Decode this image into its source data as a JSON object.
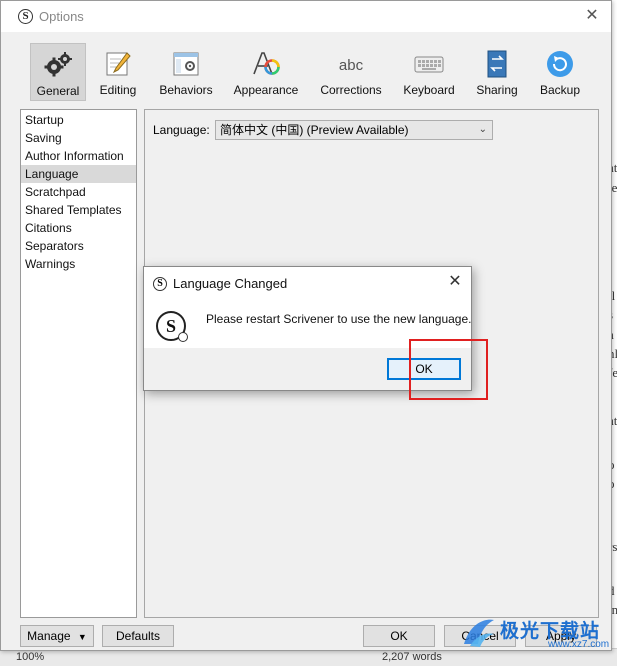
{
  "window": {
    "title": "Options"
  },
  "toolbar": {
    "items": [
      {
        "label": "General",
        "icon": "gears-icon",
        "active": true
      },
      {
        "label": "Editing",
        "icon": "pencil-note-icon"
      },
      {
        "label": "Behaviors",
        "icon": "window-gear-icon"
      },
      {
        "label": "Appearance",
        "icon": "font-palette-icon"
      },
      {
        "label": "Corrections",
        "icon": "abc-icon"
      },
      {
        "label": "Keyboard",
        "icon": "keyboard-icon"
      },
      {
        "label": "Sharing",
        "icon": "sync-document-icon"
      },
      {
        "label": "Backup",
        "icon": "backup-circle-icon"
      }
    ]
  },
  "sidebar": {
    "items": [
      {
        "label": "Startup"
      },
      {
        "label": "Saving"
      },
      {
        "label": "Author Information"
      },
      {
        "label": "Language",
        "selected": true
      },
      {
        "label": "Scratchpad"
      },
      {
        "label": "Shared Templates"
      },
      {
        "label": "Citations"
      },
      {
        "label": "Separators"
      },
      {
        "label": "Warnings"
      }
    ]
  },
  "content": {
    "language_label": "Language:",
    "language_value": "简体中文 (中国) (Preview Available)"
  },
  "footer": {
    "manage": "Manage",
    "defaults": "Defaults",
    "ok": "OK",
    "cancel": "Cancel",
    "apply": "Apply"
  },
  "dialog": {
    "title": "Language Changed",
    "message": "Please restart Scrivener to use the new language.",
    "ok": "OK"
  },
  "background": {
    "zoom": "100%",
    "words": "2,207 words",
    "lines": [
      "at",
      "le",
      "tl",
      "s",
      "a",
      "nl",
      "fe",
      "at",
      "o",
      "o",
      "l i",
      "rs",
      "d",
      "in"
    ]
  },
  "watermark": {
    "text": "极光下载站",
    "url": "www.xz7.com"
  },
  "colors": {
    "accent": "#0078d7",
    "highlight": "#e02020",
    "watermark": "#1e6fcf"
  }
}
